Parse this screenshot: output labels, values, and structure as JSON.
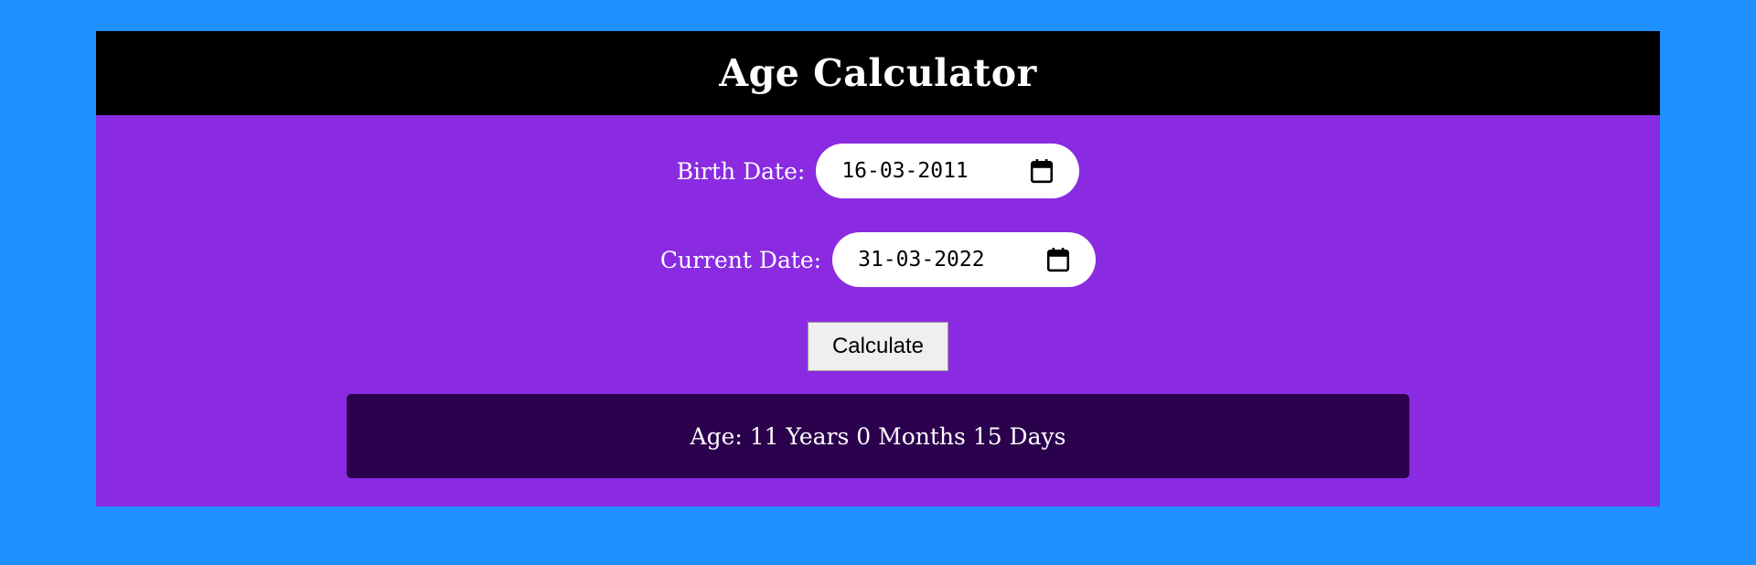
{
  "header": {
    "title": "Age Calculator"
  },
  "form": {
    "birth_label": "Birth Date:",
    "birth_value": "16-03-2011",
    "current_label": "Current Date:",
    "current_value": "31-03-2022",
    "calculate_label": "Calculate"
  },
  "result": {
    "text": "Age: 11 Years 0 Months 15 Days"
  },
  "icons": {
    "birth_picker": "calendar-icon",
    "current_picker": "calendar-icon"
  },
  "colors": {
    "page_background": "#1e90ff",
    "card_background": "#8a2be2",
    "header_background": "#000000",
    "result_background": "#2b004d",
    "text": "#ffffff"
  }
}
